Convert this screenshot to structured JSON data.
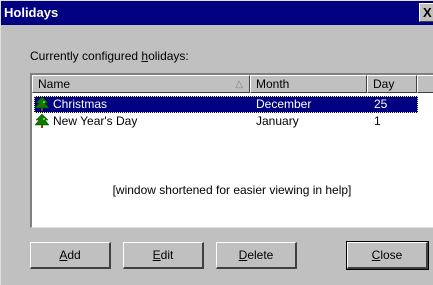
{
  "window": {
    "title": "Holidays",
    "close_glyph": "X"
  },
  "caption": {
    "pre": "Currently configured ",
    "mnemonic": "h",
    "post": "olidays:"
  },
  "list": {
    "columns": [
      "Name",
      "Month",
      "Day"
    ],
    "sort_indicator": "△",
    "rows": [
      {
        "name": "Christmas",
        "month": "December",
        "day": "25",
        "selected": true,
        "icon": "christmas-tree-icon"
      },
      {
        "name": "New Year's Day",
        "month": "January",
        "day": "1",
        "selected": false,
        "icon": "christmas-tree-icon"
      }
    ],
    "note": "[window shortened for easier viewing in help]"
  },
  "buttons": {
    "add": {
      "mnemonic": "A",
      "rest": "dd"
    },
    "edit": {
      "mnemonic": "E",
      "rest": "dit"
    },
    "delete": {
      "mnemonic": "D",
      "rest": "elete"
    },
    "close": {
      "mnemonic": "C",
      "rest": "lose"
    }
  },
  "colors": {
    "selection": "#000080",
    "titlebar": "#000080",
    "face": "#c0c0c0"
  }
}
